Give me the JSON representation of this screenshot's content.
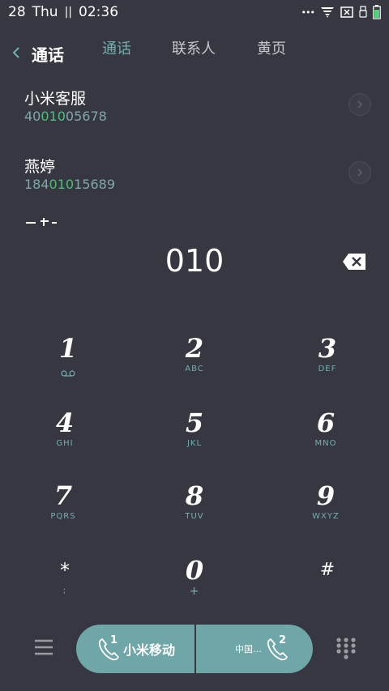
{
  "status": {
    "date": "28",
    "weekday": "Thu",
    "separator": "||",
    "time": "02:36",
    "more": "•••"
  },
  "header": {
    "title": "通话",
    "tabs": [
      {
        "label": "通话",
        "active": true
      },
      {
        "label": "联系人",
        "active": false
      },
      {
        "label": "黄页",
        "active": false
      }
    ]
  },
  "results": [
    {
      "name": "小米客服",
      "number_pre": "40",
      "number_match": "010",
      "number_post": "05678"
    },
    {
      "name": "燕婷",
      "number_pre": "184",
      "number_match": "010",
      "number_post": "15689"
    }
  ],
  "dialed": "010",
  "keypad": [
    {
      "digit": "1",
      "sub": "ᴑᴑ"
    },
    {
      "digit": "2",
      "sub": "ABC"
    },
    {
      "digit": "3",
      "sub": "DEF"
    },
    {
      "digit": "4",
      "sub": "GHI"
    },
    {
      "digit": "5",
      "sub": "JKL"
    },
    {
      "digit": "6",
      "sub": "MNO"
    },
    {
      "digit": "7",
      "sub": "PQRS"
    },
    {
      "digit": "8",
      "sub": "TUV"
    },
    {
      "digit": "9",
      "sub": "WXYZ"
    },
    {
      "digit": "*",
      "sub": ";"
    },
    {
      "digit": "0",
      "sub": "+"
    },
    {
      "digit": "#",
      "sub": ""
    }
  ],
  "call": {
    "sim1_label": "小米移动",
    "sim1_index": "1",
    "sim2_label": "中国…",
    "sim2_index": "2"
  },
  "colors": {
    "background": "#363740",
    "accent": "#6fb0b2",
    "match": "#4dbf7a",
    "call_button": "#6fa6a7"
  }
}
